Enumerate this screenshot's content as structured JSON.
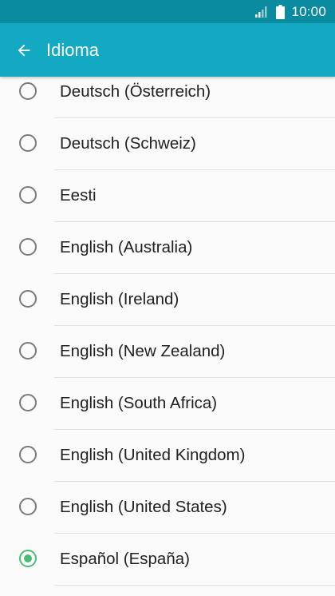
{
  "status_bar": {
    "time": "10:00",
    "icons": [
      "signal-icon",
      "battery-icon"
    ],
    "color": "#0b8ba0"
  },
  "app_bar": {
    "title": "Idioma",
    "back_icon": "arrow-back-icon",
    "color": "#14a9c2"
  },
  "languages": [
    {
      "label": "Deutsch (Österreich)",
      "selected": false
    },
    {
      "label": "Deutsch (Schweiz)",
      "selected": false
    },
    {
      "label": "Eesti",
      "selected": false
    },
    {
      "label": "English (Australia)",
      "selected": false
    },
    {
      "label": "English (Ireland)",
      "selected": false
    },
    {
      "label": "English (New Zealand)",
      "selected": false
    },
    {
      "label": "English (South Africa)",
      "selected": false
    },
    {
      "label": "English (United Kingdom)",
      "selected": false
    },
    {
      "label": "English (United States)",
      "selected": false
    },
    {
      "label": "Español (España)",
      "selected": true
    }
  ],
  "accent_color": "#4cbb75"
}
